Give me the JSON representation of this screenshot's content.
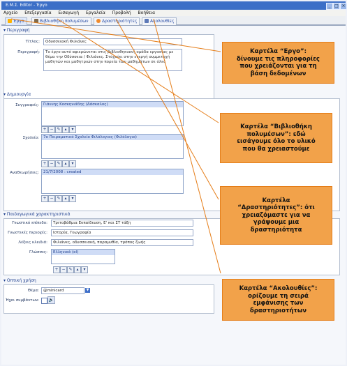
{
  "window": {
    "title": "Ε.Μ.Σ. Editor - Έργο"
  },
  "menu": [
    "Αρχείο",
    "Επεξεργασία",
    "Εισαγωγή",
    "Εργαλεία",
    "Προβολή",
    "Βοήθεια"
  ],
  "tabs": [
    {
      "label": "Έργο",
      "active": true
    },
    {
      "label": "Βιβλιοθήκη πολυμέσων",
      "active": false
    },
    {
      "label": "Δραστηριότητες",
      "active": false
    },
    {
      "label": "Ακολουθίες",
      "active": false
    }
  ],
  "sections": {
    "project": {
      "title": "Περιγραφή",
      "title_field_label": "Τίτλος:",
      "title_value": "Οδυσσειακή Φιλιάνες",
      "description_label": "Περιγραφή:",
      "description_value": "Το έργο αυτό αφιερώνεται στις βιβλιοθηκιακή ομάδα εργασίας με θέμα την Οδύσσεια / Φιλιάνες. Στόχεύει στην ενεργή συμμετοχή μαθητών και μαθητριών στην πορεία των μαθημάτων σε όλες"
    },
    "authoring": {
      "title": "Δημιουργία",
      "authors_label": "Συγγραφείς:",
      "authors_value": "Γιάννης Κοσκηνιάδης (Δάσκαλος)",
      "school_label": "Σχολείο:",
      "school_value": "7ο Πειραματικό Σχολείο Φιλόλογιας (Φιλόλογιο)",
      "revisions_label": "Αναθεωρήσεις:",
      "revisions_value": "21/7/2008 : created"
    },
    "pedagogy": {
      "title": "Παιδαγωγικά χαρακτηριστικά",
      "level_label": "Γνωστικό επίπεδο:",
      "level_value": "Τριτοβάθμια Εκπαίδευση, Ε' και ΣΤ τάξη",
      "area_label": "Γνωστικές περιοχές:",
      "area_value": "Ιστορία, Γεωγραφία",
      "keywords_label": "Λέξεις κλειδιά:",
      "keywords_value": "Φιλιάνες, οδυσσειακή, παραμυθία, τρόπος ζωής",
      "languages_label": "Γλώσσες:",
      "languages_value": "Ελληνικά (el)"
    },
    "appearance": {
      "title": "Οπτική χρήση",
      "theme_label": "Θέμα:",
      "theme_value": "@minicard",
      "sound_label": "Ήχοι συμβάντων:"
    }
  },
  "callouts": [
    {
      "text": "Καρτέλα “Εργο”:\nδίνουμε τις πληροφορίες\nπου χρειάζονται για τη\nβάση δεδομένων"
    },
    {
      "text": "Καρτέλα “Βιβλιοθήκη\nπολυμέσων”: εδώ\nεισάγουμε όλο το υλικό\nπου θα χρειαστούμε"
    },
    {
      "text": "Καρτέλα\n“Δραστηριότητες”: ότι\nχρειαζόμαστε για να\nγράψουμε μια\nδραστηριότητα"
    },
    {
      "text": "Καρτέλα “Ακολουθίες”:\nορίζουμε τη σειρά\nεμφάνισης των\nδραστηριοτήτων"
    }
  ],
  "colors": {
    "callout_fill": "#f2a24a",
    "callout_border": "#e57d18",
    "titlebar": "#3c6fc7"
  }
}
